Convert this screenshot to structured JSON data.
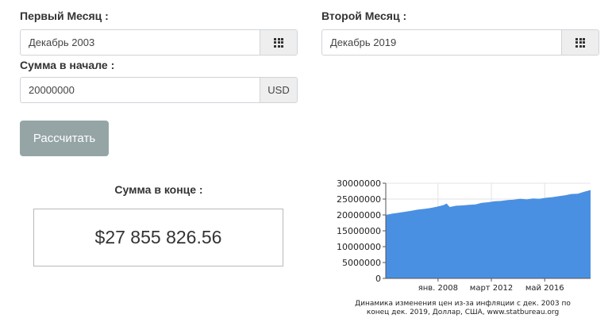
{
  "form": {
    "first_month_label": "Первый Месяц :",
    "first_month_value": "Декабрь 2003",
    "second_month_label": "Второй Месяц :",
    "second_month_value": "Декабрь 2019",
    "start_amount_label": "Сумма в начале :",
    "start_amount_value": "20000000",
    "currency": "USD",
    "calendar_icon": "calendar-grid-icon",
    "calculate_label": "Рассчитать"
  },
  "result": {
    "label": "Сумма в конце :",
    "value": "$27 855 826.56"
  },
  "chart_data": {
    "type": "area",
    "x_start": "2003-12",
    "x_end": "2019-12",
    "x_tick_labels": [
      {
        "date": "2008-01",
        "label": "янв. 2008"
      },
      {
        "date": "2012-03",
        "label": "март 2012"
      },
      {
        "date": "2016-05",
        "label": "май 2016"
      }
    ],
    "y_ticks": [
      0,
      5000000,
      10000000,
      15000000,
      20000000,
      25000000,
      30000000
    ],
    "y_tick_labels": [
      "0",
      "5000000",
      "10000000",
      "15000000",
      "20000000",
      "25000000",
      "30000000"
    ],
    "ylim": [
      0,
      30000000
    ],
    "grid": true,
    "color": "#4a90e2",
    "series": [
      {
        "x": [
          "2003-12",
          "2004-06",
          "2004-12",
          "2005-06",
          "2005-12",
          "2006-06",
          "2006-12",
          "2007-06",
          "2007-12",
          "2008-06",
          "2008-09",
          "2008-12",
          "2009-06",
          "2009-12",
          "2010-06",
          "2010-12",
          "2011-06",
          "2011-12",
          "2012-06",
          "2012-12",
          "2013-06",
          "2013-12",
          "2014-06",
          "2014-12",
          "2015-06",
          "2015-12",
          "2016-06",
          "2016-12",
          "2017-06",
          "2017-12",
          "2018-06",
          "2018-12",
          "2019-06",
          "2019-12"
        ],
        "y": [
          20000000,
          20400000,
          20700000,
          21000000,
          21300000,
          21700000,
          21900000,
          22200000,
          22600000,
          23100000,
          23600000,
          22500000,
          22900000,
          23000000,
          23200000,
          23300000,
          23800000,
          24000000,
          24300000,
          24400000,
          24700000,
          24800000,
          25100000,
          24900000,
          25200000,
          25100000,
          25400000,
          25600000,
          25900000,
          26200000,
          26600000,
          26700000,
          27300000,
          27855826.56
        ]
      }
    ]
  },
  "caption": {
    "line1": "Динамика изменения цен из-за инфляции с дек. 2003 по",
    "line2": "конец дек. 2019, Доллар, США, www.statbureau.org"
  }
}
